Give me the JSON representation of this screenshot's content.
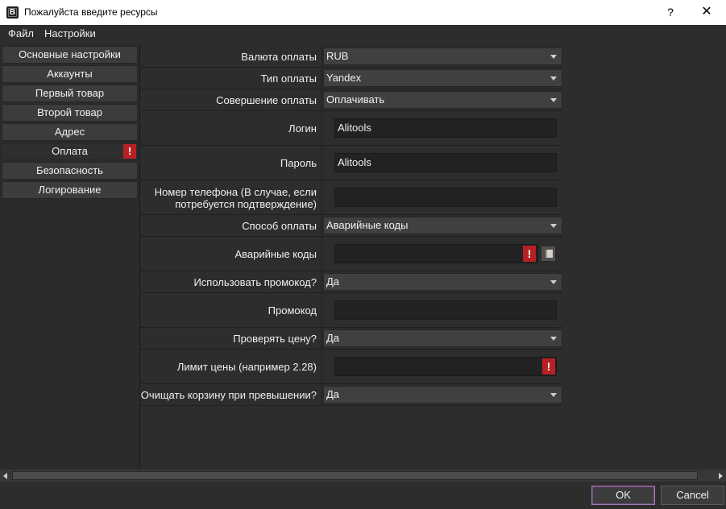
{
  "window": {
    "title": "Пожалуйста введите ресурсы",
    "icon_letter": "B",
    "help": "?",
    "close": "✕"
  },
  "menu": {
    "items": [
      {
        "label": "Файл"
      },
      {
        "label": "Настройки"
      }
    ]
  },
  "sidebar": {
    "items": [
      {
        "label": "Основные настройки"
      },
      {
        "label": "Аккаунты"
      },
      {
        "label": "Первый товар"
      },
      {
        "label": "Второй товар"
      },
      {
        "label": "Адрес"
      },
      {
        "label": "Оплата",
        "active": true,
        "warning": "!"
      },
      {
        "label": "Безопасность"
      },
      {
        "label": "Логирование"
      }
    ]
  },
  "form": {
    "currency": {
      "label": "Валюта оплаты",
      "value": "RUB"
    },
    "payment_type": {
      "label": "Тип оплаты",
      "value": "Yandex"
    },
    "payment_action": {
      "label": "Совершение оплаты",
      "value": "Оплачивать"
    },
    "login": {
      "label": "Логин",
      "value": "Alitools"
    },
    "password": {
      "label": "Пароль",
      "value": "Alitools"
    },
    "phone": {
      "label_line1": "Номер телефона (В случае, если",
      "label_line2": "потребуется подтверждение)",
      "value": ""
    },
    "payment_method": {
      "label": "Способ оплаты",
      "value": "Аварийные коды"
    },
    "emergency_codes": {
      "label": "Аварийные коды",
      "value": "",
      "warning": "!"
    },
    "use_promo": {
      "label": "Использовать промокод?",
      "value": "Да"
    },
    "promo": {
      "label": "Промокод",
      "value": ""
    },
    "check_price": {
      "label": "Проверять цену?",
      "value": "Да"
    },
    "price_limit": {
      "label": "Лимит цены (например 2.28)",
      "value": "",
      "warning": "!"
    },
    "clear_cart": {
      "label": "Очищать корзину при превышении?",
      "value": "Да"
    }
  },
  "footer": {
    "ok": "OK",
    "cancel": "Cancel"
  }
}
